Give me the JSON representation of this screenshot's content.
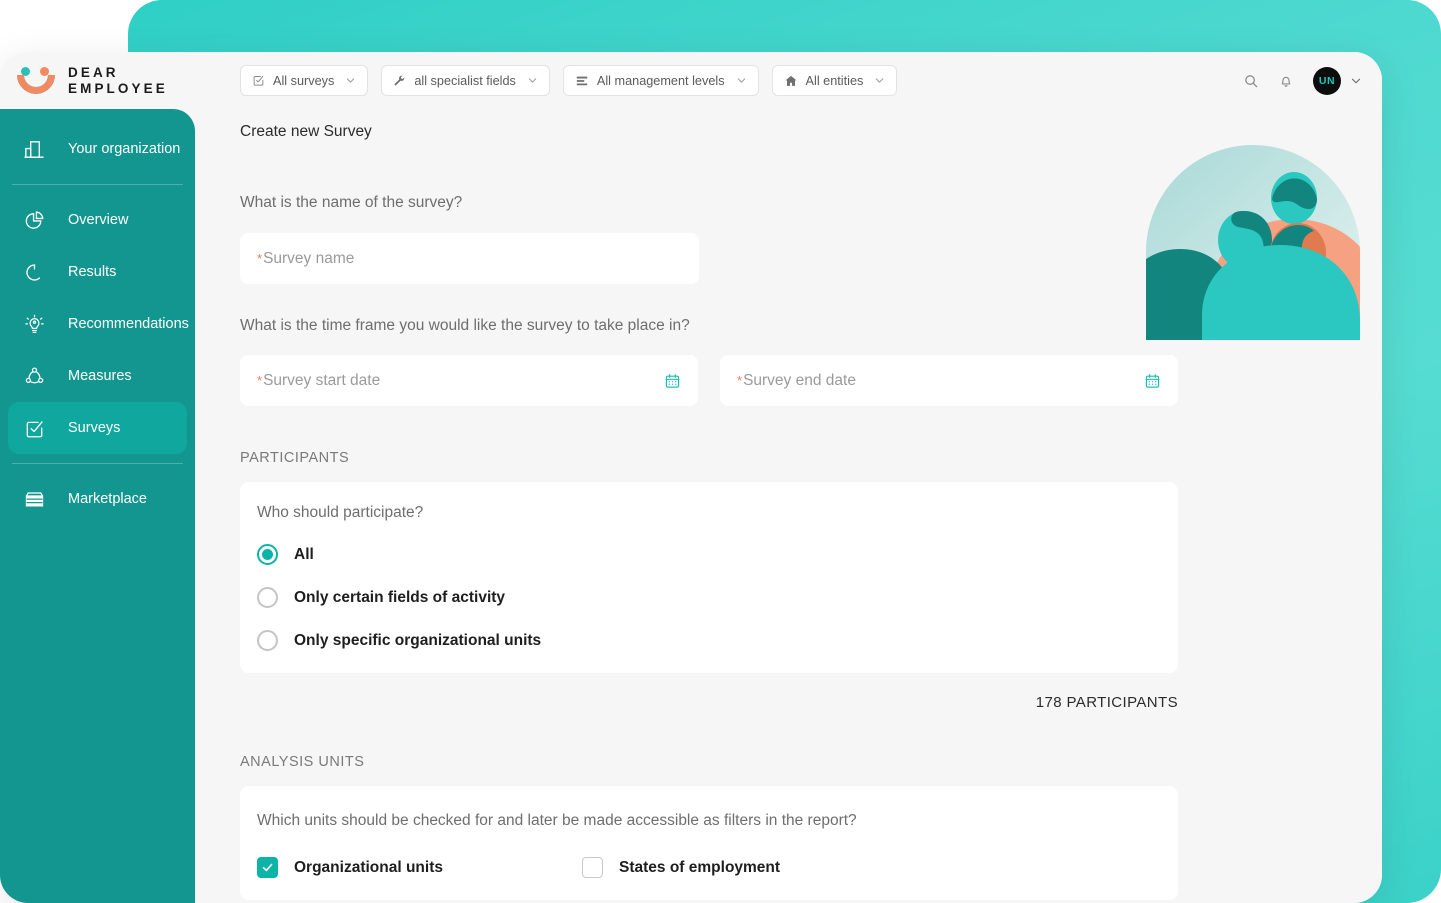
{
  "brand": {
    "name_line1": "DEAR",
    "name_line2": "EMPLOYEE",
    "accent_teal": "#0bb3a8",
    "accent_orange": "#f08a63",
    "sidebar_bg": "#12968f",
    "sidebar_active_bg": "#0fa79e",
    "page_bg": "#f6f6f6",
    "backdrop_gradient_from": "#2fcfc6",
    "backdrop_gradient_to": "#3bd2c9"
  },
  "sidebar": {
    "items": [
      {
        "id": "your-organization",
        "label": "Your organization",
        "icon": "building-icon",
        "active": false
      },
      {
        "id": "overview",
        "label": "Overview",
        "icon": "pie-chart-icon",
        "active": false
      },
      {
        "id": "results",
        "label": "Results",
        "icon": "donut-progress-icon",
        "active": false
      },
      {
        "id": "recommendations",
        "label": "Recommendations",
        "icon": "lightbulb-icon",
        "active": false
      },
      {
        "id": "measures",
        "label": "Measures",
        "icon": "network-nodes-icon",
        "active": false
      },
      {
        "id": "surveys",
        "label": "Surveys",
        "icon": "checkbox-check-icon",
        "active": true
      },
      {
        "id": "marketplace",
        "label": "Marketplace",
        "icon": "storefront-icon",
        "active": false
      }
    ]
  },
  "topbar": {
    "filters": [
      {
        "id": "all-surveys",
        "label": "All surveys",
        "icon": "checkbox-square-icon"
      },
      {
        "id": "all-specialist-fields",
        "label": "all specialist fields",
        "icon": "wrench-icon"
      },
      {
        "id": "all-management-levels",
        "label": "All management levels",
        "icon": "layers-list-icon"
      },
      {
        "id": "all-entities",
        "label": "All entities",
        "icon": "home-icon"
      }
    ],
    "search_icon": "search-icon",
    "notifications_icon": "bell-icon",
    "avatar_initials": "UN",
    "avatar_chevron_icon": "chevron-down-icon"
  },
  "main": {
    "page_title": "Create new Survey",
    "survey_name": {
      "question": "What is the name of the survey?",
      "placeholder": "Survey name",
      "required_marker": "*",
      "value": ""
    },
    "time_frame": {
      "question": "What is the time frame you would like the survey to take place in?",
      "start": {
        "placeholder": "Survey start date",
        "required_marker": "*",
        "value": "",
        "icon": "calendar-icon"
      },
      "end": {
        "placeholder": "Survey end date",
        "required_marker": "*",
        "value": "",
        "icon": "calendar-icon"
      }
    },
    "participants": {
      "section_title": "PARTICIPANTS",
      "question": "Who should participate?",
      "options": [
        {
          "id": "all",
          "label": "All",
          "selected": true
        },
        {
          "id": "fields-of-activity",
          "label": "Only certain fields of activity",
          "selected": false
        },
        {
          "id": "org-units",
          "label": "Only specific organizational units",
          "selected": false
        }
      ],
      "count_text": "178 PARTICIPANTS"
    },
    "analysis_units": {
      "section_title": "ANALYSIS UNITS",
      "question": "Which units should be checked for and later be made accessible as filters in the report?",
      "checkboxes": [
        {
          "id": "organizational-units",
          "label": "Organizational units",
          "checked": true
        },
        {
          "id": "states-of-employment",
          "label": "States of employment",
          "checked": false
        }
      ]
    },
    "illustration_name": "group-of-people-illustration"
  }
}
